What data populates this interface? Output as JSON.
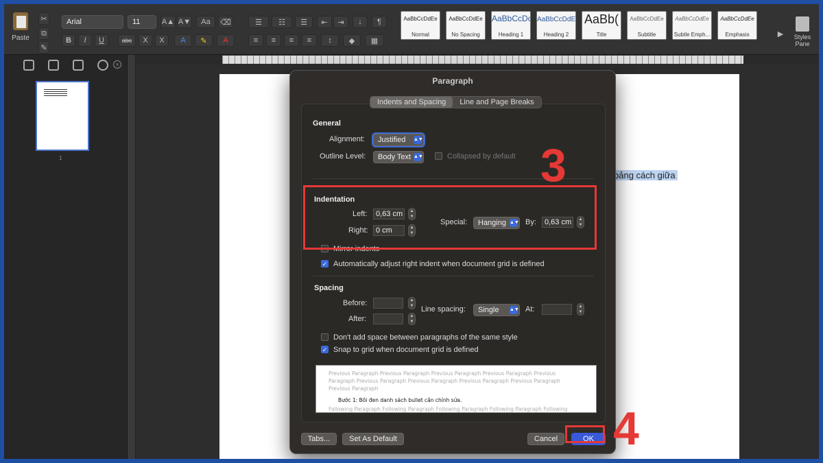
{
  "ribbon": {
    "paste_label": "Paste",
    "font_name": "Arial",
    "font_size": "11",
    "bold": "B",
    "italic": "I",
    "underline": "U",
    "strike": "abc",
    "subscript": "X",
    "superscript": "X",
    "styles": [
      {
        "sample": "AaBbCcDdEe",
        "name": "Normal"
      },
      {
        "sample": "AaBbCcDdEe",
        "name": "No Spacing"
      },
      {
        "sample": "AaBbCcDc",
        "name": "Heading 1"
      },
      {
        "sample": "AaBbCcDdE",
        "name": "Heading 2"
      },
      {
        "sample": "AaBb(",
        "name": "Title"
      },
      {
        "sample": "AaBbCcDdEe",
        "name": "Subtitle"
      },
      {
        "sample": "AaBbCcDdEe",
        "name": "Subtle Emph..."
      },
      {
        "sample": "AaBbCcDdEe",
        "name": "Emphasis"
      }
    ],
    "styles_pane": "Styles Pane"
  },
  "sidebar": {
    "page_number": "1"
  },
  "document": {
    "visible_text": "oảng cách giữa"
  },
  "dialog": {
    "title": "Paragraph",
    "tabs": [
      {
        "label": "Indents and Spacing",
        "active": true
      },
      {
        "label": "Line and Page Breaks",
        "active": false
      }
    ],
    "general": {
      "heading": "General",
      "alignment_label": "Alignment:",
      "alignment_value": "Justified",
      "outline_label": "Outline Level:",
      "outline_value": "Body Text",
      "collapsed_label": "Collapsed by default"
    },
    "indentation": {
      "heading": "Indentation",
      "left_label": "Left:",
      "left_value": "0,63 cm",
      "right_label": "Right:",
      "right_value": "0 cm",
      "special_label": "Special:",
      "special_value": "Hanging",
      "by_label": "By:",
      "by_value": "0,63 cm",
      "mirror_label": "Mirror indents",
      "auto_adjust_label": "Automatically adjust right indent when document grid is defined"
    },
    "spacing": {
      "heading": "Spacing",
      "before_label": "Before:",
      "before_value": "",
      "after_label": "After:",
      "after_value": "",
      "line_label": "Line spacing:",
      "line_value": "Single",
      "at_label": "At:",
      "at_value": "",
      "dont_add_label": "Don't add space between paragraphs of the same style",
      "snap_label": "Snap to grid when document grid is defined"
    },
    "preview": {
      "prev1": "Previous Paragraph Previous Paragraph Previous Paragraph Previous Paragraph Previous",
      "prev2": "Paragraph Previous Paragraph Previous Paragraph Previous Paragraph Previous Paragraph",
      "prev3": "Previous Paragraph",
      "current": "Bước 1: Bôi đen danh sách bullet cần chỉnh sửa.",
      "following": "Following Paragraph Following Paragraph Following Paragraph Following Paragraph Following"
    },
    "buttons": {
      "tabs": "Tabs...",
      "set_default": "Set As Default",
      "cancel": "Cancel",
      "ok": "OK"
    }
  },
  "annotations": {
    "step3": "3",
    "step4": "4",
    "color": "#e53935"
  }
}
